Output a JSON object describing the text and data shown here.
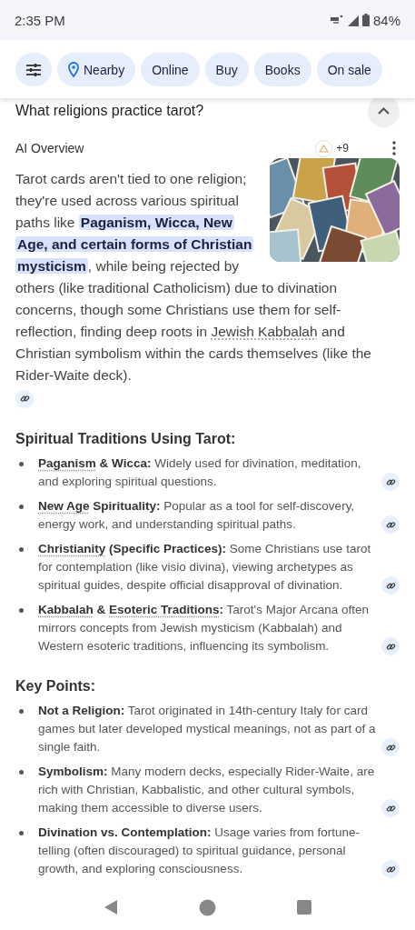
{
  "status_bar": {
    "time": "2:35 PM",
    "battery": "84%"
  },
  "chips": [
    {
      "kind": "filter"
    },
    {
      "kind": "location",
      "label": "Nearby"
    },
    {
      "kind": "text",
      "label": "Online"
    },
    {
      "kind": "text",
      "label": "Buy"
    },
    {
      "kind": "text",
      "label": "Books"
    },
    {
      "kind": "text",
      "label": "On sale"
    }
  ],
  "question": {
    "text": "What religions practice tarot?",
    "expanded": true
  },
  "overview": {
    "label": "AI Overview",
    "source_count": "+9"
  },
  "summary": {
    "parts": [
      {
        "kind": "text",
        "text": "Tarot cards aren't tied to one religion; they're used across various spiritual paths like "
      },
      {
        "kind": "highlight",
        "text": "Paganism, Wicca, New Age, and certain forms of Christian mysticism"
      },
      {
        "kind": "text",
        "text": ", while being rejected by others (like traditional Catholicism) due to divination concerns, though some Christians use them for self-reflection, finding deep roots in "
      },
      {
        "kind": "link",
        "text": "Jewish Kabbalah"
      },
      {
        "kind": "text",
        "text": " and Christian symbolism within the cards themselves (like the Rider-Waite deck)."
      }
    ]
  },
  "sections": [
    {
      "heading": "Spiritual Traditions Using Tarot:",
      "items": [
        {
          "lead": [
            {
              "kind": "link",
              "text": "Paganism"
            },
            {
              "kind": "bold",
              "text": " & Wicca:"
            }
          ],
          "text": " Widely used for divination, meditation, and exploring spiritual questions."
        },
        {
          "lead": [
            {
              "kind": "link",
              "text": "New Age"
            },
            {
              "kind": "bold",
              "text": " Spirituality:"
            }
          ],
          "text": " Popular as a tool for self-discovery, energy work, and understanding spiritual paths."
        },
        {
          "lead": [
            {
              "kind": "link",
              "text": "Christianity"
            },
            {
              "kind": "bold",
              "text": " (Specific Practices):"
            }
          ],
          "text": " Some Christians use tarot for contemplation (like visio divina), viewing archetypes as spiritual guides, despite official disapproval of divination."
        },
        {
          "lead": [
            {
              "kind": "link",
              "text": "Kabbalah"
            },
            {
              "kind": "bold",
              "text": " & "
            },
            {
              "kind": "link",
              "text": "Esoteric Traditions"
            },
            {
              "kind": "bold",
              "text": ":"
            }
          ],
          "text": " Tarot's Major Arcana often mirrors concepts from Jewish mysticism (Kabbalah) and Western esoteric traditions, influencing its symbolism."
        }
      ]
    },
    {
      "heading": "Key Points:",
      "items": [
        {
          "lead": [
            {
              "kind": "bold",
              "text": "Not a Religion:"
            }
          ],
          "text": " Tarot originated in 14th-century Italy for card games but later developed mystical meanings, not as part of a single faith."
        },
        {
          "lead": [
            {
              "kind": "bold",
              "text": "Symbolism:"
            }
          ],
          "text": " Many modern decks, especially Rider-Waite, are rich with Christian, Kabbalistic, and other cultural symbols, making them accessible to diverse users."
        },
        {
          "lead": [
            {
              "kind": "bold",
              "text": "Divination vs. Contemplation:"
            }
          ],
          "text": " Usage varies from fortune-telling (often discouraged) to spiritual guidance, personal growth, and exploring consciousness."
        }
      ]
    }
  ]
}
